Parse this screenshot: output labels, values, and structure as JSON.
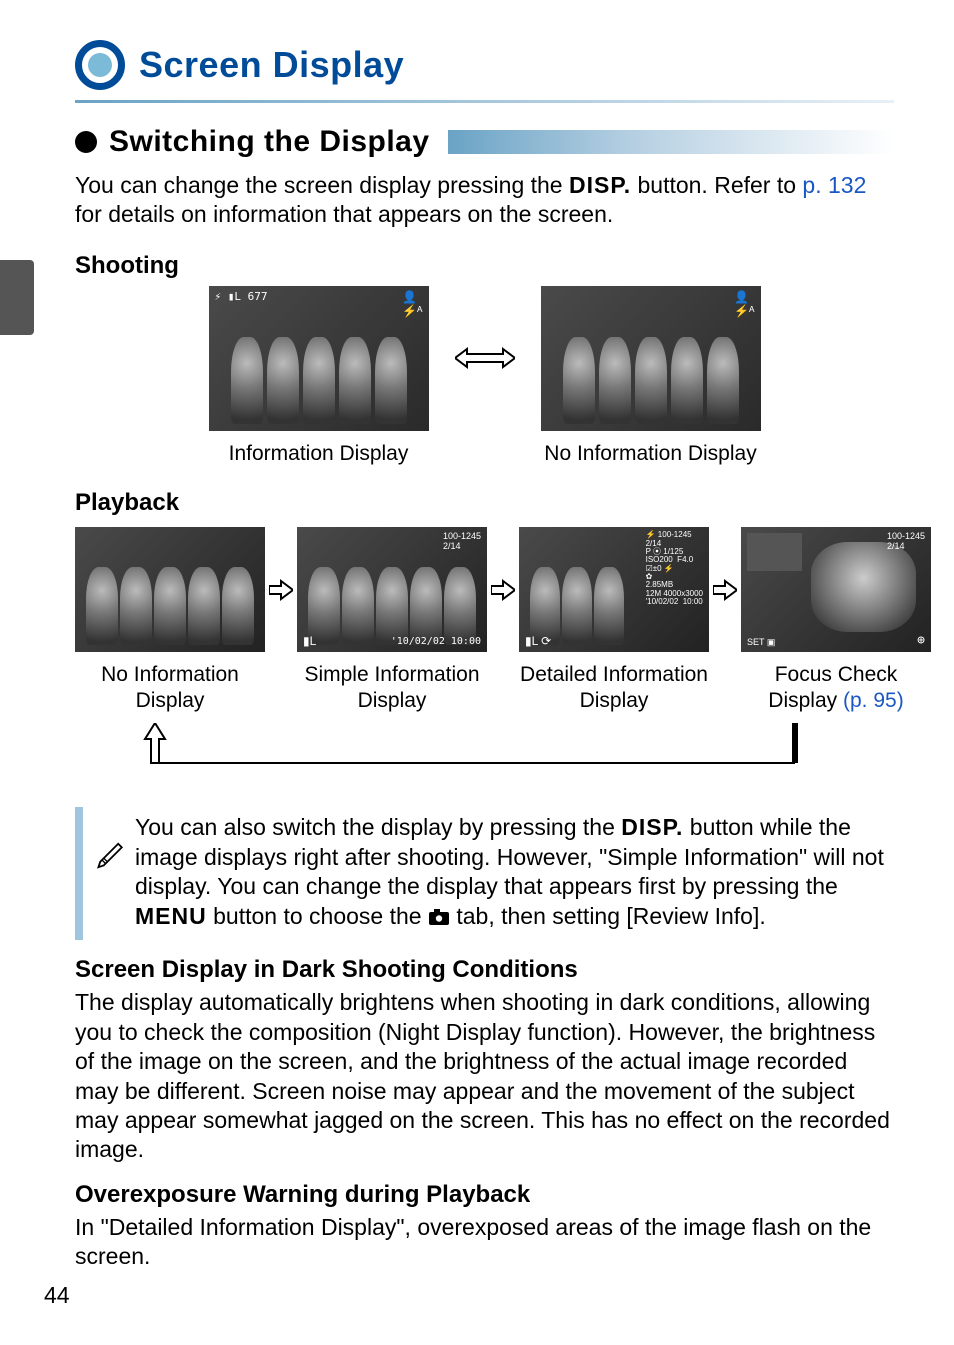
{
  "title": "Screen Display",
  "section1": {
    "heading": "Switching the Display",
    "intro_before": "You can change the screen display pressing the ",
    "disp_label": "DISP.",
    "intro_mid": " button. Refer to ",
    "page_link": "p. 132",
    "intro_after": " for details on information that appears on the screen."
  },
  "shooting": {
    "heading": "Shooting",
    "overlay_tl": "⚡ ▮L 677",
    "left_caption": "Information Display",
    "right_caption": "No Information Display"
  },
  "playback": {
    "heading": "Playback",
    "items": [
      {
        "caption": "No Information Display",
        "tr": "",
        "br": "",
        "bl": ""
      },
      {
        "caption": "Simple Information Display",
        "tr": "100-1245\n2/14",
        "br": "'10/02/02  10:00",
        "bl": "▮L"
      },
      {
        "caption": "Detailed Information Display",
        "tr": "⚡ 100-1245\n2/14\nP ⦿ 1/125\nISO200  F4.0\n☑±0 ⚡\n✿\n2.85MB\n12M 4000x3000\n'10/02/02  10:00",
        "br": "",
        "bl": "▮L ⟳"
      },
      {
        "caption_prefix": "Focus Check Display ",
        "link": "(p. 95)",
        "tr": "100-1245\n2/14",
        "br": "⊕",
        "bl": "SET ▣"
      }
    ]
  },
  "note": {
    "line1_before": "You can also switch the display by pressing the ",
    "disp": "DISP.",
    "line1_after": " button while the image displays right after shooting. However, \"Simple Information\" will not display. You can change the display that appears first by pressing the ",
    "menu": "MENU",
    "line2_mid": " button to choose the ",
    "camera_icon": "📷",
    "line2_after": " tab, then setting [Review Info]."
  },
  "dark": {
    "heading": "Screen Display in Dark Shooting Conditions",
    "body": "The display automatically brightens when shooting in dark conditions, allowing you to check the composition (Night Display function). However, the brightness of the image on the screen, and the brightness of the actual image recorded may be different. Screen noise may appear and the movement of the subject may appear somewhat jagged on the screen. This has no effect on the recorded image."
  },
  "overexposure": {
    "heading": "Overexposure Warning during Playback",
    "body": "In \"Detailed Information Display\", overexposed areas of the image flash on the screen."
  },
  "page_number": "44"
}
